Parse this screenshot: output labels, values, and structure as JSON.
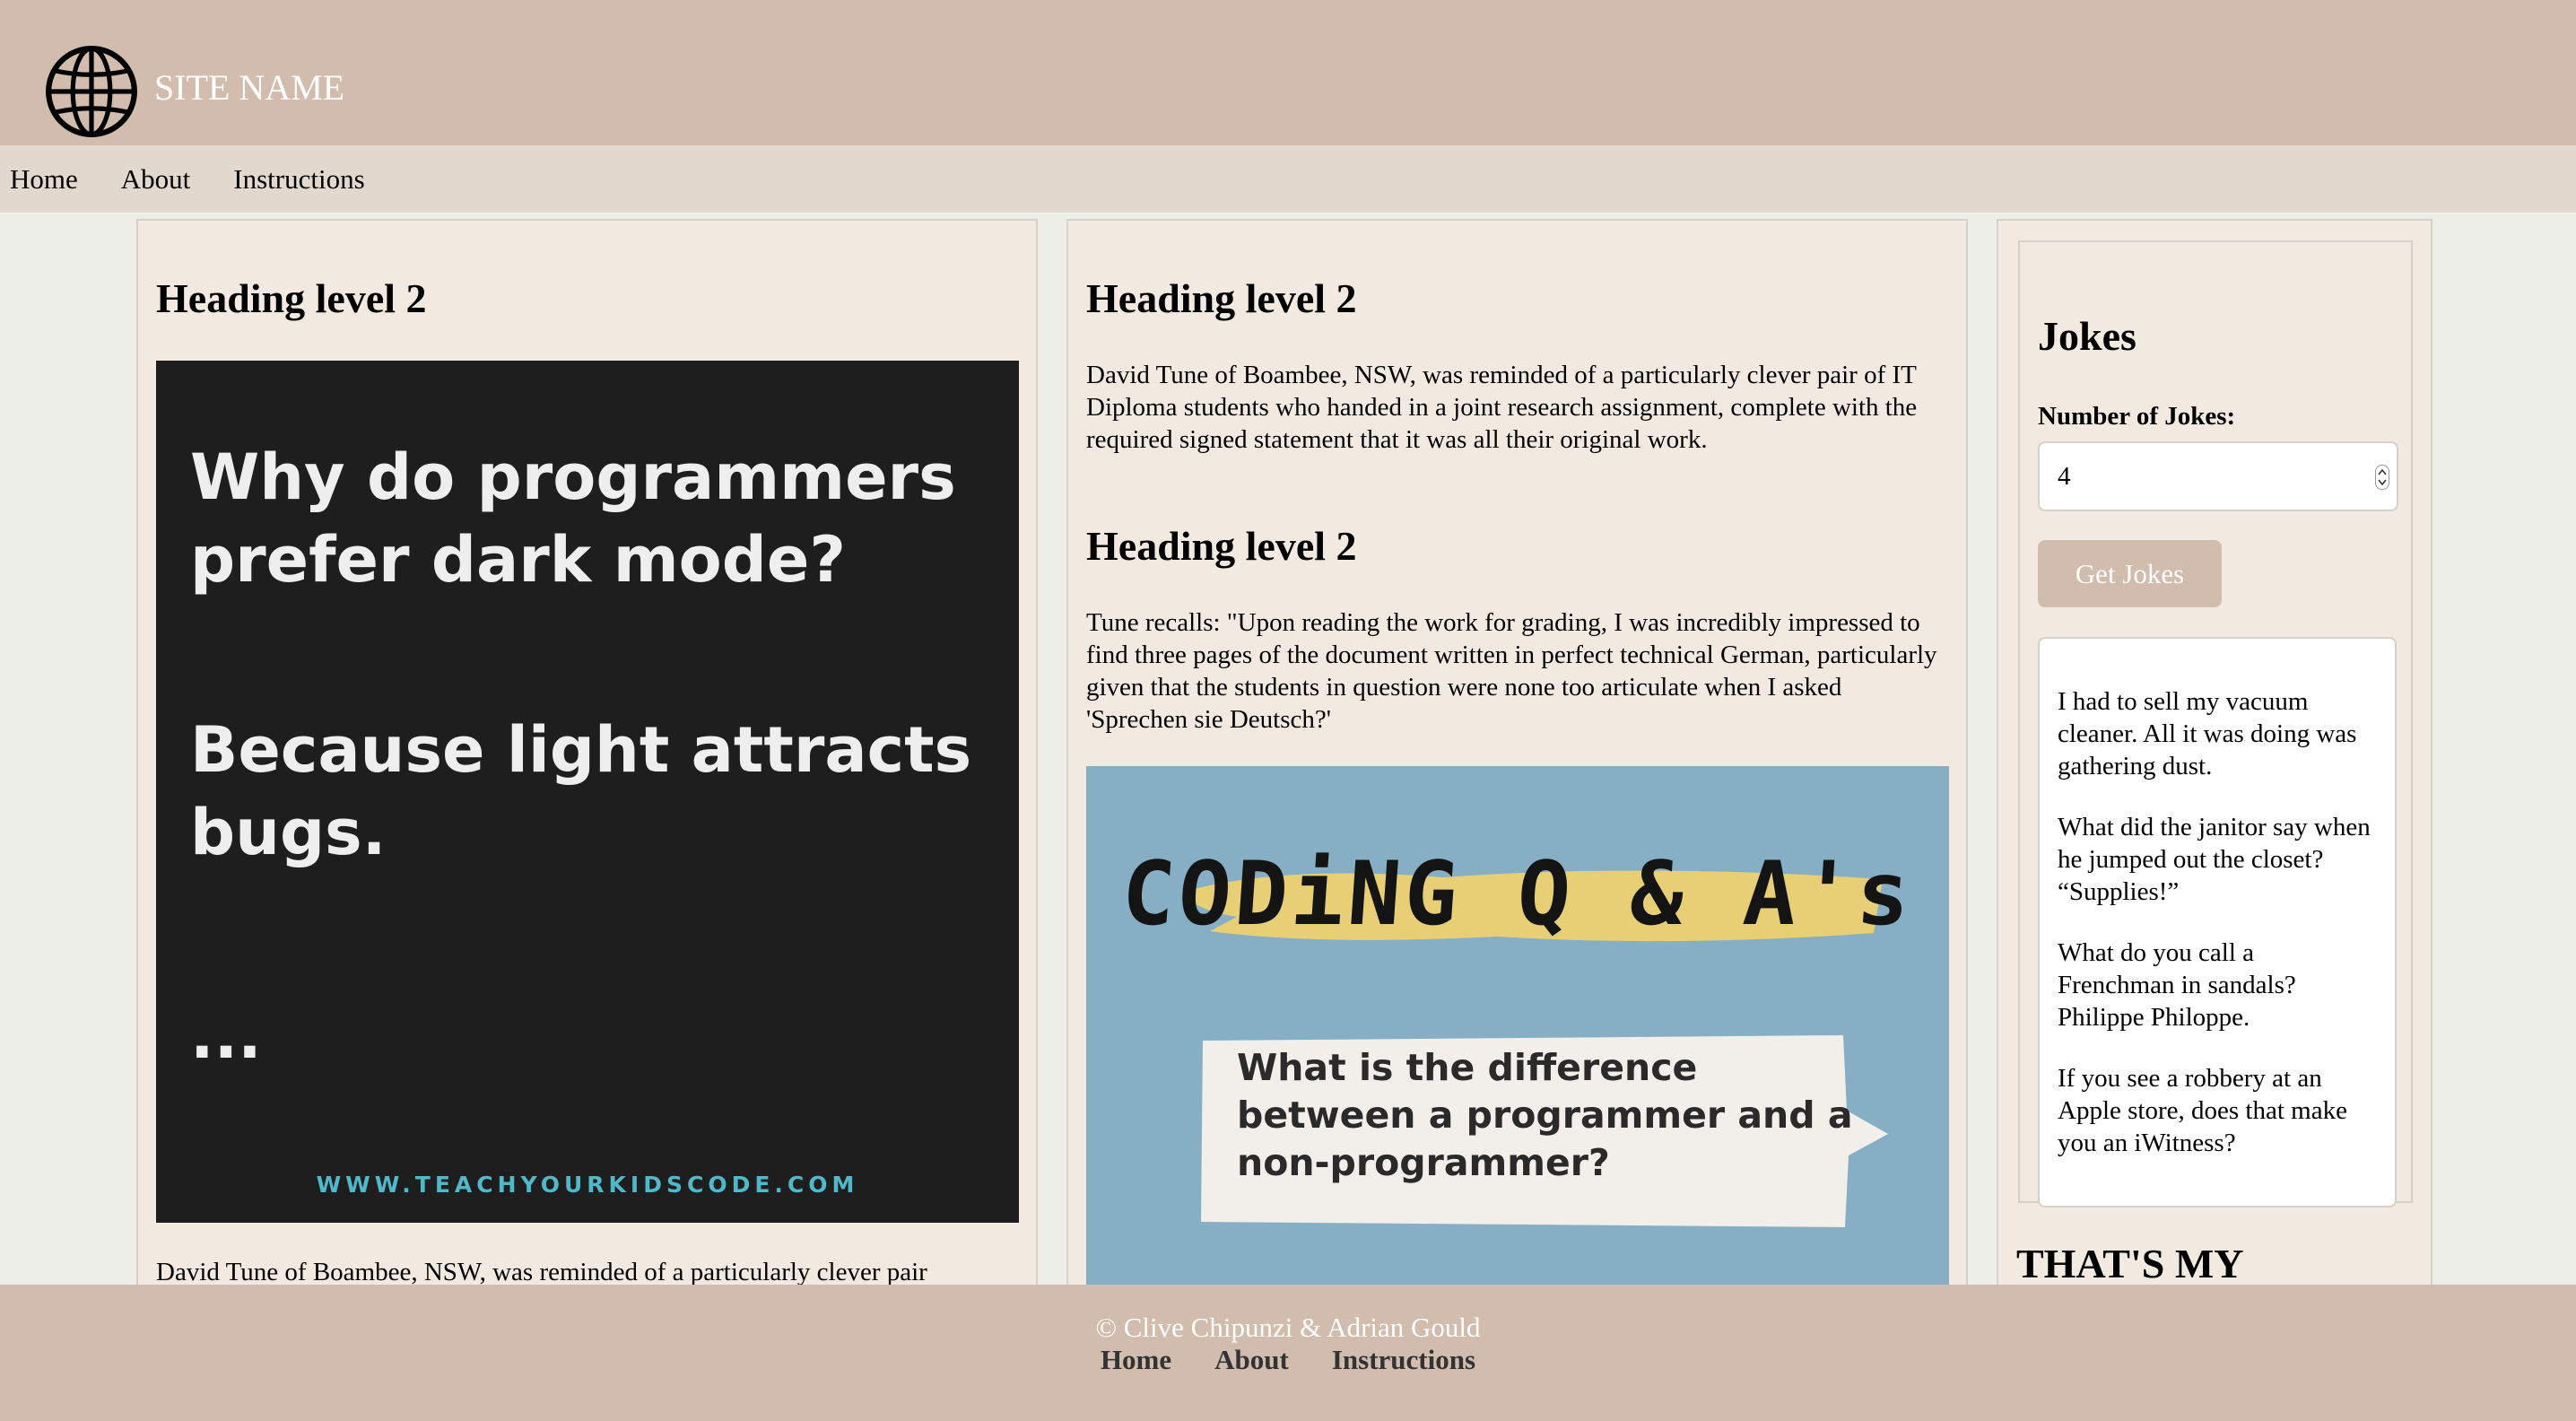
{
  "header": {
    "logo_icon": "globe-icon",
    "site_name": "SITE NAME"
  },
  "nav": {
    "items": [
      {
        "label": "Home"
      },
      {
        "label": "About"
      },
      {
        "label": "Instructions"
      }
    ]
  },
  "column1": {
    "heading": "Heading level 2",
    "image": {
      "question": "Why do programmers prefer dark mode?",
      "answer": "Because light attracts bugs.",
      "dots": "...",
      "url": "WWW.TEACHYOURKIDSCODE.COM"
    },
    "paragraph": "David Tune of Boambee, NSW, was reminded of a particularly clever pair"
  },
  "column2": {
    "heading1": "Heading level 2",
    "paragraph1": "David Tune of Boambee, NSW, was reminded of a particularly clever pair of IT Diploma students who handed in a joint research assignment, complete with the required signed statement that it was all their original work.",
    "heading2": "Heading level 2",
    "paragraph2": "Tune recalls: \"Upon reading the work for grading, I was incredibly impressed to find three pages of the document written in perfect technical German, particularly given that the students in question were none too articulate when I asked 'Sprechen sie Deutsch?'",
    "image": {
      "title": "CODiNG Q & A's",
      "question": "What is the difference between a programmer and a non-programmer?"
    }
  },
  "jokes": {
    "title": "Jokes",
    "number_label": "Number of Jokes:",
    "number_value": "4",
    "button_label": "Get Jokes",
    "items": [
      "I had to sell my vacuum cleaner. All it was doing was gathering dust.",
      "What did the janitor say when he jumped out the closet? “Supplies!”",
      "What do you call a Frenchman in sandals? Philippe Philoppe.",
      "If you see a robbery at an Apple store, does that make you an iWitness?"
    ],
    "promo_heading": "THAT'S MY"
  },
  "footer": {
    "copyright": "© Clive Chipunzi & Adrian Gould",
    "links": [
      {
        "label": "Home"
      },
      {
        "label": "About"
      },
      {
        "label": "Instructions"
      }
    ]
  },
  "colors": {
    "header_bg": "#d1bcae",
    "nav_bg": "#e2d8cd",
    "panel_bg": "#f2eae1",
    "page_bg": "#eeeee9",
    "accent_url": "#4fb8c9",
    "qa_bg": "#86afc6"
  }
}
